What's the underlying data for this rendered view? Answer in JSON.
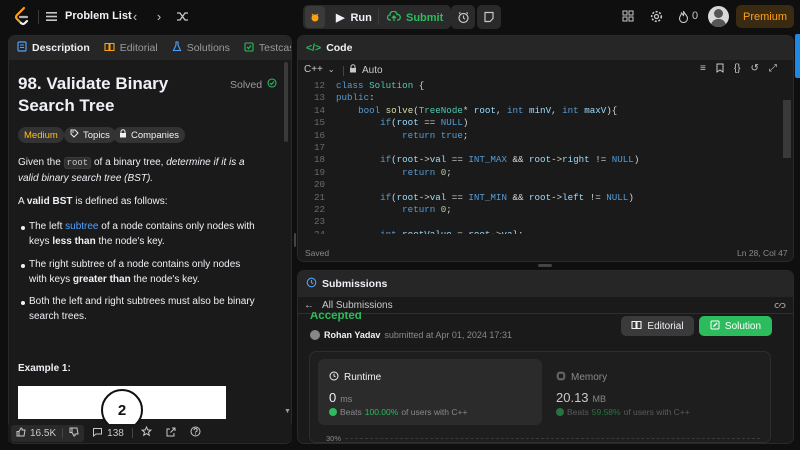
{
  "topbar": {
    "problem_list": "Problem List",
    "run": "Run",
    "submit": "Submit",
    "streak": "0",
    "premium": "Premium"
  },
  "description": {
    "tabs": [
      "Description",
      "Editorial",
      "Solutions",
      "Testcase"
    ],
    "title": "98. Validate Binary Search Tree",
    "solved": "Solved",
    "difficulty": "Medium",
    "topics": "Topics",
    "companies": "Companies",
    "p1_a": "Given the ",
    "p1_code": "root",
    "p1_b": " of a binary tree, ",
    "p1_em": "determine if it is a valid binary search tree (BST).",
    "p2_a": "A ",
    "p2_b": "valid BST",
    "p2_c": " is defined as follows:",
    "b1_a": "The left ",
    "b1_link": "subtree",
    "b1_b": " of a node contains only nodes with keys ",
    "b1_strong": "less than",
    "b1_c": " the node's key.",
    "b2_a": "The right subtree of a node contains only nodes with keys ",
    "b2_strong": "greater than",
    "b2_b": " the node's key.",
    "b3": "Both the left and right subtrees must also be binary search trees.",
    "example": "Example 1:",
    "example_node": "2",
    "likes": "16.5K",
    "comments": "138"
  },
  "code": {
    "tab": "Code",
    "language": "C++",
    "auto": "Auto",
    "status": "Saved",
    "cursor": "Ln 28, Col 47",
    "lines": [
      {
        "n": "12",
        "t": "class Solution {"
      },
      {
        "n": "13",
        "t": "public:"
      },
      {
        "n": "14",
        "t": "    bool solve(TreeNode* root, int minV, int maxV){"
      },
      {
        "n": "15",
        "t": "        if(root == NULL)"
      },
      {
        "n": "16",
        "t": "            return true;"
      },
      {
        "n": "17",
        "t": ""
      },
      {
        "n": "18",
        "t": "        if(root->val == INT_MAX && root->right != NULL)"
      },
      {
        "n": "19",
        "t": "            return 0;"
      },
      {
        "n": "20",
        "t": ""
      },
      {
        "n": "21",
        "t": "        if(root->val == INT_MIN && root->left != NULL)"
      },
      {
        "n": "22",
        "t": "            return 0;"
      },
      {
        "n": "23",
        "t": ""
      },
      {
        "n": "24",
        "t": "        int rootValue = root->val;"
      }
    ]
  },
  "submissions": {
    "tab": "Submissions",
    "all": "All Submissions",
    "status": "Accepted",
    "user": "Rohan Yadav",
    "submitted": " submitted at Apr 01, 2024 17:31",
    "editorial": "Editorial",
    "solution": "Solution",
    "runtime_label": "Runtime",
    "runtime_value": "0",
    "runtime_unit": "ms",
    "runtime_beats_a": "Beats ",
    "runtime_beats_pct": "100.00%",
    "runtime_beats_b": " of users with C++",
    "memory_label": "Memory",
    "memory_value": "20.13",
    "memory_unit": "MB",
    "memory_beats_a": "Beats ",
    "memory_beats_pct": "59.58%",
    "memory_beats_b": " of users with C++",
    "axis_tick": "30%"
  },
  "colors": {
    "accent_orange": "#ffa116",
    "accent_green": "#2cbb5d",
    "link_blue": "#4ea1ff",
    "bg": "#0f0f0f",
    "panel": "#1a1a1a"
  }
}
